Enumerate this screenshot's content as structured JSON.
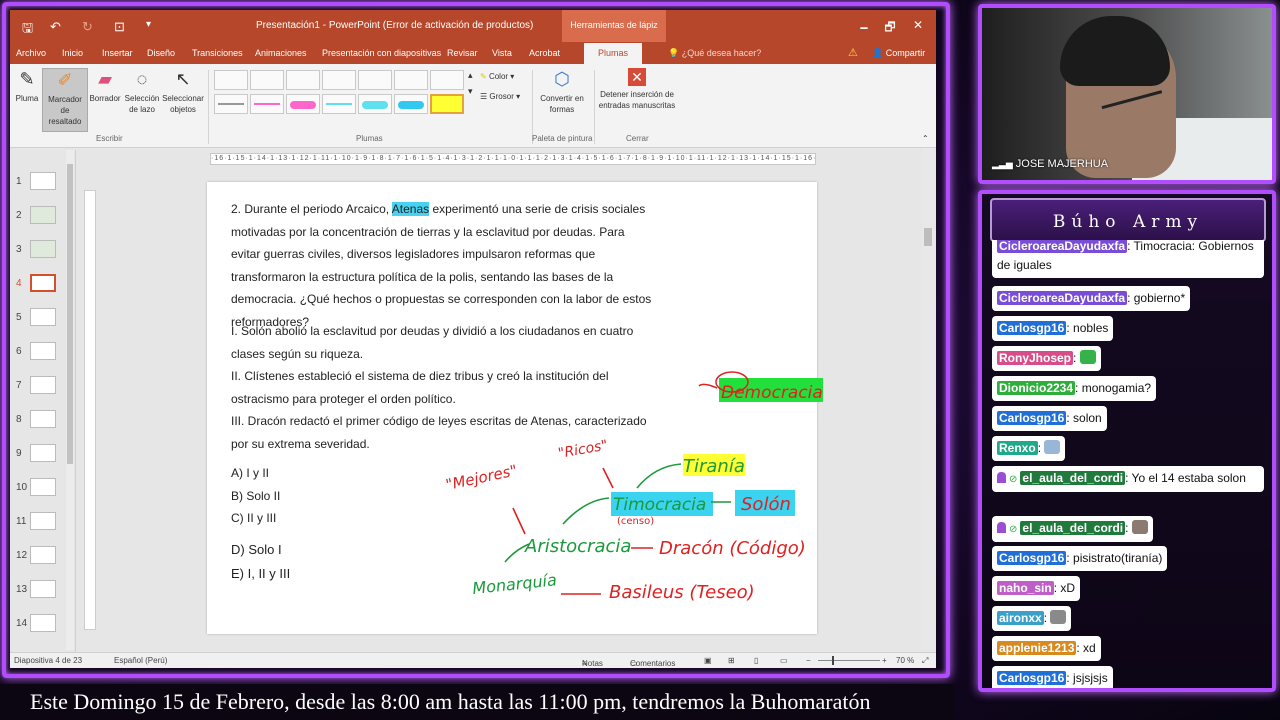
{
  "window": {
    "title": "Presentación1 - PowerPoint (Error de activación de productos)",
    "tools_tab": "Herramientas de lápiz",
    "controls": [
      "🗕",
      "🗗",
      "✕"
    ]
  },
  "tabs": [
    "Archivo",
    "Inicio",
    "Insertar",
    "Diseño",
    "Transiciones",
    "Animaciones",
    "Presentación con diapositivas",
    "Revisar",
    "Vista",
    "Acrobat",
    "Plumas"
  ],
  "tell_me": "¿Qué desea hacer?",
  "share": "Compartir",
  "ribbon": {
    "write": {
      "label": "Escribir",
      "buttons": [
        {
          "label": "Pluma",
          "icon": "pen-icon"
        },
        {
          "label": "Marcador de resaltado",
          "icon": "highlighter-icon"
        },
        {
          "label": "Borrador",
          "icon": "eraser-icon"
        },
        {
          "label": "Selección de lazo",
          "icon": "lasso-icon"
        },
        {
          "label": "Seleccionar objetos",
          "icon": "pointer-icon"
        }
      ]
    },
    "pens": {
      "label": "Plumas",
      "color_label": "Color",
      "thickness_label": "Grosor",
      "swatches": [
        "#f7f7f7",
        "#f7f7f7",
        "#f7f7f7",
        "#f7f7f7",
        "#f7f7f7",
        "#f7f7f7",
        "#f7f7f7",
        "#ff66cc",
        "#ff66cc",
        "#5fe0f0",
        "#5fe0f0",
        "#32c8f0",
        "#ffff33"
      ]
    },
    "palette": {
      "label": "Paleta de pintura",
      "convert": "Convertir en formas"
    },
    "close": {
      "label": "Cerrar",
      "stop": "Detener inserción de entradas manuscritas"
    }
  },
  "ruler": "·16·1·15·1·14·1·13·1·12·1·11·1·10·1·9·1·8·1·7·1·6·1·5·1·4·1·3·1·2·1·1·1·0·1·1·1·2·1·3·1·4·1·5·1·6·1·7·1·8·1·9·1·10·1·11·1·12·1·13·1·14·1·15·1·16·",
  "thumbnails": [
    "1",
    "2",
    "3",
    "4",
    "5",
    "6",
    "7",
    "8",
    "9",
    "10",
    "11",
    "12",
    "13",
    "14"
  ],
  "active_slide": 4,
  "slide": {
    "q_pre": "2. Durante el periodo Arcaico, ",
    "q_highlight": "Atenas",
    "q_post": " experimentó una serie de crisis sociales motivadas por la concentración de tierras y la esclavitud por deudas. Para evitar guerras civiles, diversos legisladores impulsaron reformas que transformaron la estructura política de la polis, sentando las bases de la democracia. ¿Qué hechos o propuestas se corresponden con la labor de estos reformadores?",
    "items": [
      "I. Solón abolió la esclavitud por deudas y dividió a los ciudadanos en cuatro clases según su riqueza.",
      "II. Clístenes estableció el sistema de diez tribus y creó la institución del ostracismo para proteger el orden político.",
      "III. Dracón redactó el primer código de leyes escritas de Atenas, caracterizado por su extrema severidad."
    ],
    "options": [
      "A) I y II",
      "B) Solo II",
      "C) II y III",
      "D) Solo I",
      "E) I, II y III"
    ]
  },
  "ink": {
    "democracia": "Democracia",
    "mejores": "\"Mejores\"",
    "ricos": "\"Ricos\"",
    "tirania": "Tiranía",
    "timocracia": "Timocracia",
    "censo": "(censo)",
    "solon": "Solón",
    "aristocracia": "Aristocracia",
    "dracon": "Dracón (Código)",
    "monarquia": "Monarquía",
    "basileus": "Basileus (Teseo)"
  },
  "status": {
    "slide_pos": "Diapositiva 4 de 23",
    "language": "Español (Perú)",
    "notes": "Notas",
    "comments": "Comentarios",
    "zoom": "70 %"
  },
  "webcam": {
    "name": "JOSE MAJERHUA"
  },
  "chat": {
    "title": "Búho Army",
    "messages": [
      {
        "user": "CicleroareaDayudaxfa",
        "color": "#7a4dd6",
        "text": ": Timocracia: Gobiernos de iguales",
        "emote": ""
      },
      {
        "user": "CicleroareaDayudaxfa",
        "color": "#7a4dd6",
        "text": ": gobierno*",
        "emote": ""
      },
      {
        "user": "Carlosgp16",
        "color": "#1f6fd6",
        "text": ": nobles",
        "emote": ""
      },
      {
        "user": "RonyJhosep",
        "color": "#d64d8a",
        "text": ": ",
        "emote": "#35b34a"
      },
      {
        "user": "Dionicio2234",
        "color": "#2fae3c",
        "text": ": monogamia?",
        "emote": ""
      },
      {
        "user": "Carlosgp16",
        "color": "#1f6fd6",
        "text": ": solon",
        "emote": ""
      },
      {
        "user": "Renxo",
        "color": "#1fa88a",
        "text": ": ",
        "emote": "#9ab6d6"
      },
      {
        "user": "el_aula_del_cordi",
        "color": "#1f7a3c",
        "text": ": Yo el 14 estaba solon",
        "emote": ""
      },
      {
        "user": "el_aula_del_cordi",
        "color": "#1f7a3c",
        "text": ": ",
        "emote": "#8a7a70"
      },
      {
        "user": "Carlosgp16",
        "color": "#1f6fd6",
        "text": ": pisistrato(tiranía)",
        "emote": ""
      },
      {
        "user": "naho_sin",
        "color": "#c05ec8",
        "text": ": xD",
        "emote": ""
      },
      {
        "user": "aironxx",
        "color": "#3aa0c8",
        "text": ": ",
        "emote": "#8a8a8a"
      },
      {
        "user": "applenie1213",
        "color": "#d68a1f",
        "text": ": xd",
        "emote": ""
      },
      {
        "user": "Carlosgp16",
        "color": "#1f6fd6",
        "text": ": jsjsjsjs",
        "emote": ""
      }
    ]
  },
  "ticker": "Este Domingo 15 de Febrero, desde las 8:00 am hasta las 11:00 pm, tendremos la Buhomaratón"
}
